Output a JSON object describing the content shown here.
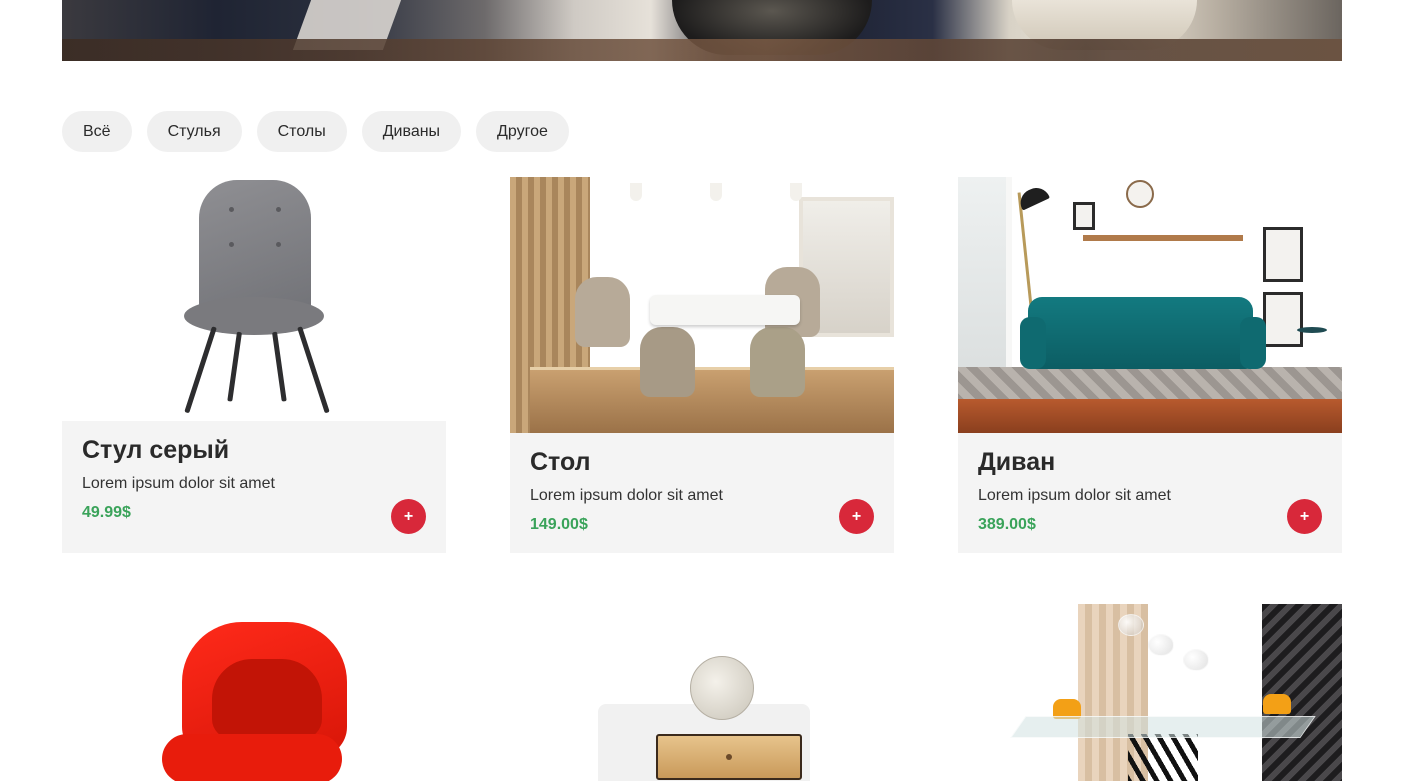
{
  "filters": [
    "Всё",
    "Стулья",
    "Столы",
    "Диваны",
    "Другое"
  ],
  "products": [
    {
      "title": "Стул серый",
      "desc": "Lorem ipsum dolor sit amet",
      "price": "49.99$",
      "add": "+"
    },
    {
      "title": "Стол",
      "desc": "Lorem ipsum dolor sit amet",
      "price": "149.00$",
      "add": "+"
    },
    {
      "title": "Диван",
      "desc": "Lorem ipsum dolor sit amet",
      "price": "389.00$",
      "add": "+"
    }
  ],
  "colors": {
    "accent_button": "#d8283a",
    "price": "#3aa35a",
    "card_bg": "#f4f4f4",
    "filter_bg": "#f0f0f0"
  }
}
